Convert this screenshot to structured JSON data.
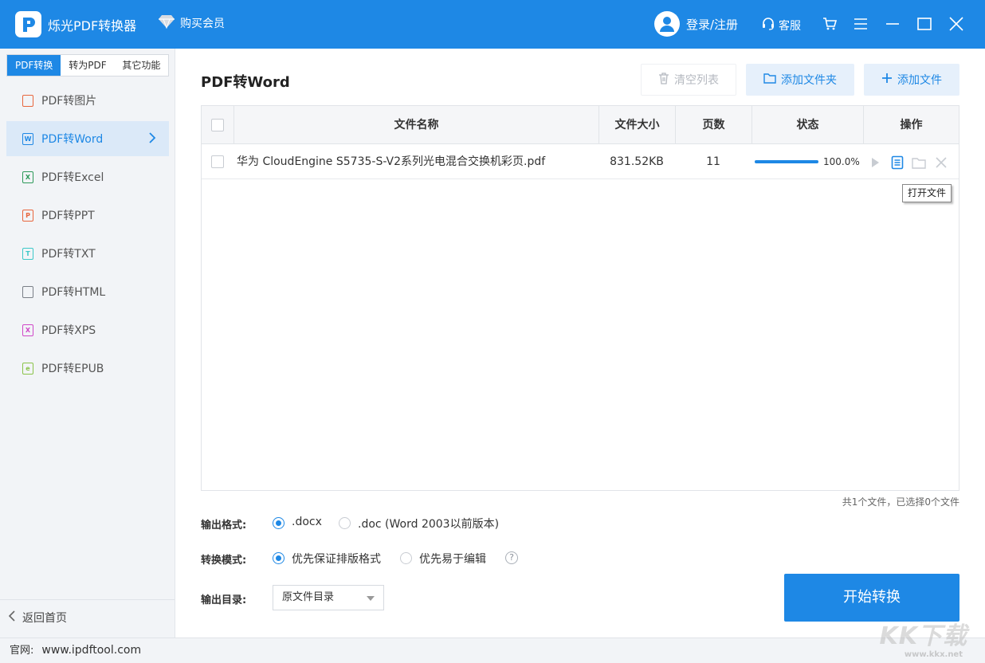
{
  "app": {
    "title": "烁光PDF转换器",
    "vip_label": "购买会员",
    "login_label": "登录/注册",
    "service_label": "客服"
  },
  "sidebar": {
    "tabs": [
      {
        "label": "PDF转换",
        "active": true
      },
      {
        "label": "转为PDF",
        "active": false
      },
      {
        "label": "其它功能",
        "active": false
      }
    ],
    "items": [
      {
        "label": "PDF转图片",
        "icon": "image-file-icon",
        "color": "#e8663d",
        "active": false
      },
      {
        "label": "PDF转Word",
        "icon": "word-file-icon",
        "color": "#1e88e5",
        "active": true
      },
      {
        "label": "PDF转Excel",
        "icon": "excel-file-icon",
        "color": "#2e9a5a",
        "active": false
      },
      {
        "label": "PDF转PPT",
        "icon": "ppt-file-icon",
        "color": "#e8663d",
        "active": false
      },
      {
        "label": "PDF转TXT",
        "icon": "txt-file-icon",
        "color": "#3cc8c8",
        "active": false
      },
      {
        "label": "PDF转HTML",
        "icon": "html-file-icon",
        "color": "#7a7f87",
        "active": false
      },
      {
        "label": "PDF转XPS",
        "icon": "xps-file-icon",
        "color": "#d048c8",
        "active": false
      },
      {
        "label": "PDF转EPUB",
        "icon": "epub-file-icon",
        "color": "#8bc34a",
        "active": false
      }
    ],
    "back_label": "返回首页"
  },
  "main": {
    "page_title": "PDF转Word",
    "buttons": {
      "clear": "清空列表",
      "add_folder": "添加文件夹",
      "add_file": "添加文件"
    },
    "table": {
      "headers": [
        "文件名称",
        "文件大小",
        "页数",
        "状态",
        "操作"
      ],
      "rows": [
        {
          "name": "华为 CloudEngine S5735-S-V2系列光电混合交换机彩页.pdf",
          "size": "831.52KB",
          "pages": "11",
          "progress": 1.0,
          "progress_label": "100.0%"
        }
      ]
    },
    "tooltip": "打开文件",
    "summary": "共1个文件，已选择0个文件",
    "output_format": {
      "label": "输出格式:",
      "options": [
        ".docx",
        ".doc (Word 2003以前版本)"
      ],
      "selected": ".docx"
    },
    "convert_mode": {
      "label": "转换模式:",
      "options": [
        "优先保证排版格式",
        "优先易于编辑"
      ],
      "selected": "优先保证排版格式",
      "help": "?"
    },
    "output_dir": {
      "label": "输出目录:",
      "value": "原文件目录"
    },
    "start_label": "开始转换"
  },
  "statusbar": {
    "label": "官网:",
    "url": "www.ipdftool.com"
  },
  "watermark": {
    "text": "KK下载",
    "sub": "www.kkx.net"
  },
  "colors": {
    "accent": "#1e88e5",
    "sidebar_bg": "#f2f4f7"
  }
}
